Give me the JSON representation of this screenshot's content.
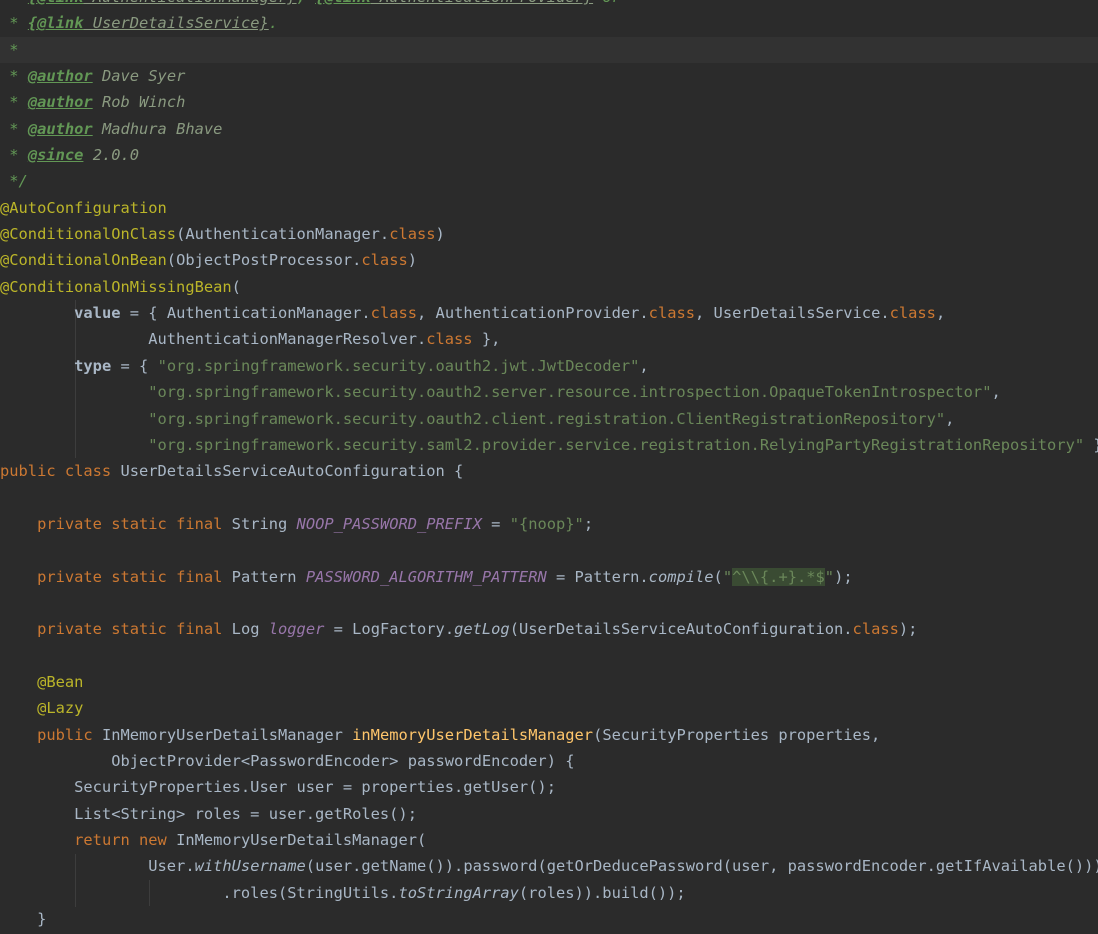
{
  "palette": {
    "background": "#2b2b2b",
    "current_line_background": "#323232",
    "plain_text": "#a9b7c6",
    "keyword": "#cc7832",
    "annotation": "#bbb529",
    "string": "#6a8759",
    "doc_comment": "#629755",
    "doc_tag_value": "#8a9a80",
    "constant_field": "#9876aa",
    "method_declaration": "#ffc66b",
    "regex_fragment_background": "#3a4b33"
  },
  "code": {
    "lines": [
      {
        "s": [
          [
            "doc",
            " * "
          ],
          [
            "doctag",
            "{@link"
          ],
          [
            "doclink",
            " AuthenticationManager}"
          ],
          [
            "doc",
            ", "
          ],
          [
            "doctag",
            "{@link"
          ],
          [
            "doclink",
            " AuthenticationProvider}"
          ],
          [
            "doc",
            " or"
          ]
        ]
      },
      {
        "s": [
          [
            "doc",
            " * "
          ],
          [
            "doctag",
            "{@link"
          ],
          [
            "doclink",
            " UserDetailsService}"
          ],
          [
            "doc",
            "."
          ]
        ]
      },
      {
        "s": [
          [
            "doc",
            " *"
          ]
        ],
        "hl": true
      },
      {
        "s": [
          [
            "doc",
            " * "
          ],
          [
            "doctag",
            "@author"
          ],
          [
            "docval",
            " Dave Syer"
          ]
        ]
      },
      {
        "s": [
          [
            "doc",
            " * "
          ],
          [
            "doctag",
            "@author"
          ],
          [
            "docval",
            " Rob Winch"
          ]
        ]
      },
      {
        "s": [
          [
            "doc",
            " * "
          ],
          [
            "doctag",
            "@author"
          ],
          [
            "docval",
            " Madhura Bhave"
          ]
        ]
      },
      {
        "s": [
          [
            "doc",
            " * "
          ],
          [
            "doctag",
            "@since"
          ],
          [
            "docval",
            " 2.0.0"
          ]
        ]
      },
      {
        "s": [
          [
            "doc",
            " */"
          ]
        ]
      },
      {
        "s": [
          [
            "ann",
            "@AutoConfiguration"
          ]
        ]
      },
      {
        "s": [
          [
            "ann",
            "@ConditionalOnClass"
          ],
          [
            "plain",
            "(AuthenticationManager."
          ],
          [
            "kw",
            "class"
          ],
          [
            "plain",
            ")"
          ]
        ]
      },
      {
        "s": [
          [
            "ann",
            "@ConditionalOnBean"
          ],
          [
            "plain",
            "(ObjectPostProcessor."
          ],
          [
            "kw",
            "class"
          ],
          [
            "plain",
            ")"
          ]
        ]
      },
      {
        "s": [
          [
            "ann",
            "@ConditionalOnMissingBean"
          ],
          [
            "plain",
            "("
          ]
        ]
      },
      {
        "s": [
          [
            "plain",
            "        "
          ],
          [
            "attr",
            "value"
          ],
          [
            "plain",
            " = { AuthenticationManager."
          ],
          [
            "kw",
            "class"
          ],
          [
            "plain",
            ", AuthenticationProvider."
          ],
          [
            "kw",
            "class"
          ],
          [
            "plain",
            ", UserDetailsService."
          ],
          [
            "kw",
            "class"
          ],
          [
            "plain",
            ","
          ]
        ]
      },
      {
        "s": [
          [
            "plain",
            "                AuthenticationManagerResolver."
          ],
          [
            "kw",
            "class"
          ],
          [
            "plain",
            " },"
          ]
        ]
      },
      {
        "s": [
          [
            "plain",
            "        "
          ],
          [
            "attr",
            "type"
          ],
          [
            "plain",
            " = { "
          ],
          [
            "str",
            "\"org.springframework.security.oauth2.jwt.JwtDecoder\""
          ],
          [
            "plain",
            ","
          ]
        ]
      },
      {
        "s": [
          [
            "plain",
            "                "
          ],
          [
            "str",
            "\"org.springframework.security.oauth2.server.resource.introspection.OpaqueTokenIntrospector\""
          ],
          [
            "plain",
            ","
          ]
        ]
      },
      {
        "s": [
          [
            "plain",
            "                "
          ],
          [
            "str",
            "\"org.springframework.security.oauth2.client.registration.ClientRegistrationRepository\""
          ],
          [
            "plain",
            ","
          ]
        ]
      },
      {
        "s": [
          [
            "plain",
            "                "
          ],
          [
            "str",
            "\"org.springframework.security.saml2.provider.service.registration.RelyingPartyRegistrationRepository\""
          ],
          [
            "plain",
            " })"
          ]
        ]
      },
      {
        "s": [
          [
            "kw",
            "public class"
          ],
          [
            "plain",
            " UserDetailsServiceAutoConfiguration {"
          ]
        ]
      },
      {
        "s": []
      },
      {
        "s": [
          [
            "plain",
            "    "
          ],
          [
            "kw",
            "private static final"
          ],
          [
            "plain",
            " String "
          ],
          [
            "field",
            "NOOP_PASSWORD_PREFIX"
          ],
          [
            "plain",
            " = "
          ],
          [
            "str",
            "\"{noop}\""
          ],
          [
            "plain",
            ";"
          ]
        ]
      },
      {
        "s": []
      },
      {
        "s": [
          [
            "plain",
            "    "
          ],
          [
            "kw",
            "private static final"
          ],
          [
            "plain",
            " Pattern "
          ],
          [
            "field",
            "PASSWORD_ALGORITHM_PATTERN"
          ],
          [
            "plain",
            " = Pattern."
          ],
          [
            "smeth",
            "compile"
          ],
          [
            "plain",
            "("
          ],
          [
            "str",
            "\""
          ],
          [
            "rex",
            "^\\\\{.+}.*$"
          ],
          [
            "str",
            "\""
          ],
          [
            "plain",
            ");"
          ]
        ]
      },
      {
        "s": []
      },
      {
        "s": [
          [
            "plain",
            "    "
          ],
          [
            "kw",
            "private static final"
          ],
          [
            "plain",
            " Log "
          ],
          [
            "field",
            "logger"
          ],
          [
            "plain",
            " = LogFactory."
          ],
          [
            "smeth",
            "getLog"
          ],
          [
            "plain",
            "(UserDetailsServiceAutoConfiguration."
          ],
          [
            "kw",
            "class"
          ],
          [
            "plain",
            ");"
          ]
        ]
      },
      {
        "s": []
      },
      {
        "s": [
          [
            "plain",
            "    "
          ],
          [
            "ann",
            "@Bean"
          ]
        ]
      },
      {
        "s": [
          [
            "plain",
            "    "
          ],
          [
            "ann",
            "@Lazy"
          ]
        ]
      },
      {
        "s": [
          [
            "plain",
            "    "
          ],
          [
            "kw",
            "public"
          ],
          [
            "plain",
            " InMemoryUserDetailsManager "
          ],
          [
            "mdecl",
            "inMemoryUserDetailsManager"
          ],
          [
            "plain",
            "(SecurityProperties properties,"
          ]
        ]
      },
      {
        "s": [
          [
            "plain",
            "            ObjectProvider<PasswordEncoder> passwordEncoder) {"
          ]
        ]
      },
      {
        "s": [
          [
            "plain",
            "        SecurityProperties.User user = properties.getUser();"
          ]
        ]
      },
      {
        "s": [
          [
            "plain",
            "        List<String> roles = user.getRoles();"
          ]
        ]
      },
      {
        "s": [
          [
            "plain",
            "        "
          ],
          [
            "kw",
            "return new"
          ],
          [
            "plain",
            " InMemoryUserDetailsManager("
          ]
        ]
      },
      {
        "s": [
          [
            "plain",
            "                User."
          ],
          [
            "smeth",
            "withUsername"
          ],
          [
            "plain",
            "(user.getName()).password(getOrDeducePassword(user, passwordEncoder.getIfAvailable()))"
          ]
        ]
      },
      {
        "s": [
          [
            "plain",
            "                        .roles(StringUtils."
          ],
          [
            "smeth",
            "toStringArray"
          ],
          [
            "plain",
            "(roles)).build());"
          ]
        ]
      },
      {
        "s": [
          [
            "plain",
            "    }"
          ]
        ]
      }
    ]
  }
}
